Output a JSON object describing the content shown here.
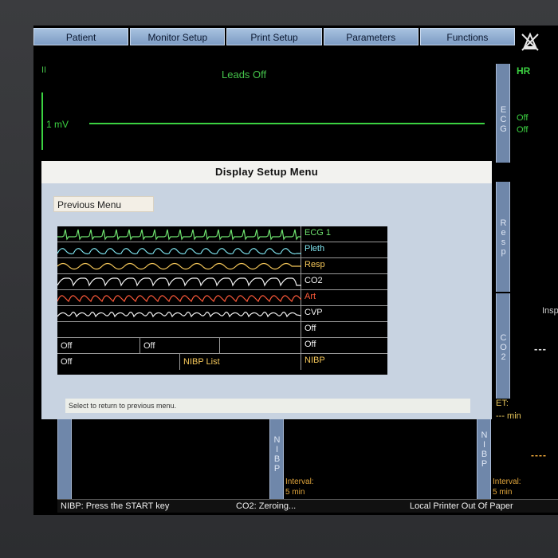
{
  "menu": {
    "items": [
      "Patient",
      "Monitor Setup",
      "Print Setup",
      "Parameters",
      "Functions"
    ],
    "alarm_silence_icon": "alarm-silenced-icon"
  },
  "ecg": {
    "lead": "II",
    "status": "Leads Off",
    "scale": "1 mV",
    "rail_label": "ECG",
    "hr_label": "HR",
    "hr_off1": "Off",
    "hr_off2": "Off"
  },
  "dialog": {
    "title": "Display Setup Menu",
    "previous_menu": "Previous Menu",
    "help_text": "Select to return to previous menu.",
    "waveforms": [
      {
        "label": "ECG 1",
        "color": "#6fe36f"
      },
      {
        "label": "Pleth",
        "color": "#7fe3ee"
      },
      {
        "label": "Resp",
        "color": "#f6c85a"
      },
      {
        "label": "CO2",
        "color": "#f2f2f2"
      },
      {
        "label": "Art",
        "color": "#ff5a3a"
      },
      {
        "label": "CVP",
        "color": "#f2f2f2"
      },
      {
        "label": "Off",
        "color": "#f2f2f2"
      }
    ],
    "row8": {
      "c1": "Off",
      "c2": "Off",
      "label": "Off"
    },
    "row9": {
      "c1": "Off",
      "c2": "NIBP List",
      "label": "NIBP",
      "c2_color": "#f6c85a",
      "label_color": "#f6c85a"
    }
  },
  "rails": {
    "resp": "Resp",
    "co2": "CO2",
    "nibp_left": "NIBP",
    "nibp_right": "NIBP"
  },
  "right_panel": {
    "insp": "Insp",
    "value_dashes": "---",
    "et": "ET:",
    "et_min": "--- min",
    "nibp_dashes": "----"
  },
  "bottom": {
    "interval_label": "Interval:",
    "interval_left": "5 min",
    "interval_right": "5 min"
  },
  "status_bar": {
    "nibp": "NIBP: Press the START key",
    "co2": "CO2: Zeroing...",
    "printer": "Local Printer Out Of Paper"
  }
}
